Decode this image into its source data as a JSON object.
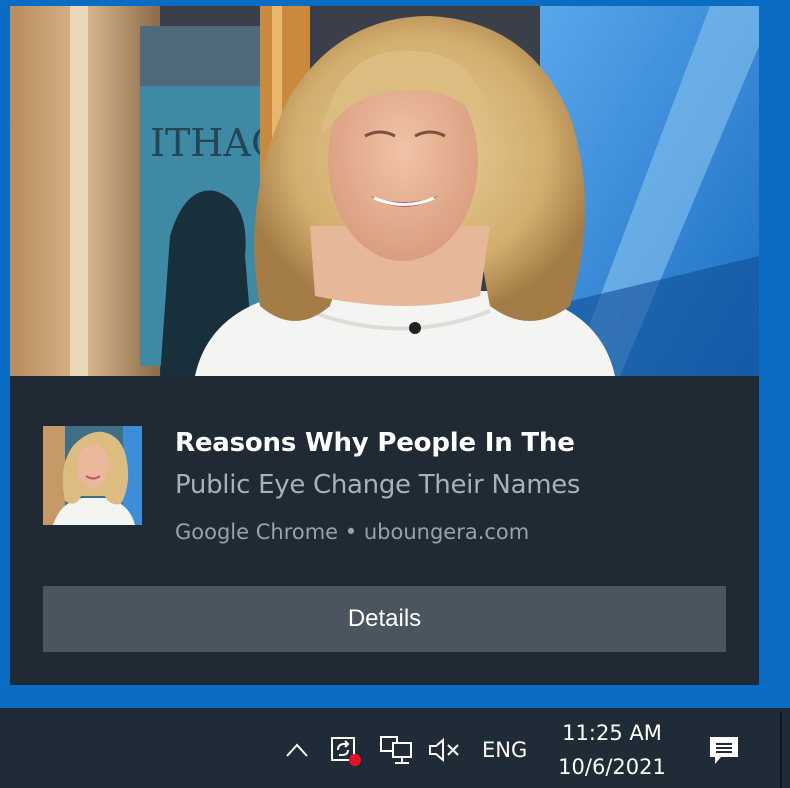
{
  "notification": {
    "title": "Reasons Why People In The",
    "subtitle": "Public Eye Change Their Names",
    "attribution": "Google Chrome • uboungera.com",
    "details_label": "Details"
  },
  "taskbar": {
    "icons": [
      "chevron-up-icon",
      "update-icon",
      "network-icon",
      "volume-muted-icon",
      "action-center-icon"
    ],
    "language": "ENG",
    "time": "11:25 AM",
    "date": "10/6/2021"
  },
  "colors": {
    "desktop": "#0a6cc2",
    "toast_bg": "#1f2a35",
    "button_bg": "#4b5560",
    "taskbar_bg": "#1f2b37",
    "badge": "#e81123"
  }
}
